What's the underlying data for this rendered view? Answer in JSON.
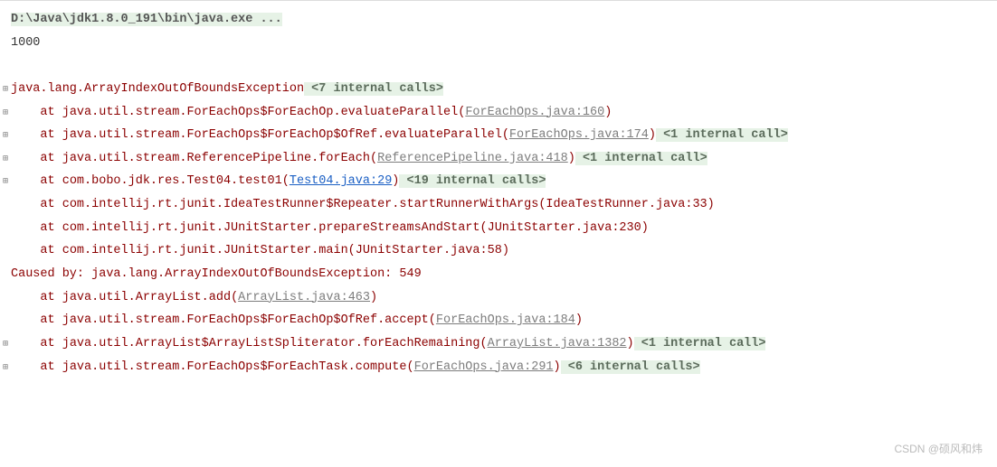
{
  "header": {
    "command": "D:\\Java\\jdk1.8.0_191\\bin\\java.exe ...",
    "output": "1000"
  },
  "trace": {
    "exception_class": "java.lang.ArrayIndexOutOfBoundsException",
    "badge_top": " <7 internal calls>",
    "frames": [
      {
        "at": "at ",
        "pkg": "java.util.stream.ForEachOps$ForEachOp.evaluateParallel",
        "open": "(",
        "link": "ForEachOps.java:160",
        "close": ")",
        "badge": "",
        "link_style": "grey",
        "fold": true
      },
      {
        "at": "at ",
        "pkg": "java.util.stream.ForEachOps$ForEachOp$OfRef.evaluateParallel",
        "open": "(",
        "link": "ForEachOps.java:174",
        "close": ")",
        "badge": " <1 internal call>",
        "link_style": "grey",
        "fold": true
      },
      {
        "at": "at ",
        "pkg": "java.util.stream.ReferencePipeline.forEach",
        "open": "(",
        "link": "ReferencePipeline.java:418",
        "close": ")",
        "badge": " <1 internal call>",
        "link_style": "grey",
        "fold": true
      },
      {
        "at": "at ",
        "pkg": "com.bobo.jdk.res.Test04.test01",
        "open": "(",
        "link": "Test04.java:29",
        "close": ")",
        "badge": " <19 internal calls>",
        "link_style": "blue",
        "fold": true
      },
      {
        "at": "at ",
        "pkg": "com.intellij.rt.junit.IdeaTestRunner$Repeater.startRunnerWithArgs",
        "open": "(",
        "link": "IdeaTestRunner.java:33",
        "close": ")",
        "badge": "",
        "link_style": "plain",
        "fold": false
      },
      {
        "at": "at ",
        "pkg": "com.intellij.rt.junit.JUnitStarter.prepareStreamsAndStart",
        "open": "(",
        "link": "JUnitStarter.java:230",
        "close": ")",
        "badge": "",
        "link_style": "plain",
        "fold": false
      },
      {
        "at": "at ",
        "pkg": "com.intellij.rt.junit.JUnitStarter.main",
        "open": "(",
        "link": "JUnitStarter.java:58",
        "close": ")",
        "badge": "",
        "link_style": "plain",
        "fold": false
      }
    ],
    "caused_by_label": "Caused by: ",
    "caused_by_exc": "java.lang.ArrayIndexOutOfBoundsException: 549",
    "caused_frames": [
      {
        "at": "at ",
        "pkg": "java.util.ArrayList.add",
        "open": "(",
        "link": "ArrayList.java:463",
        "close": ")",
        "badge": "",
        "link_style": "grey",
        "fold": false
      },
      {
        "at": "at ",
        "pkg": "java.util.stream.ForEachOps$ForEachOp$OfRef.accept",
        "open": "(",
        "link": "ForEachOps.java:184",
        "close": ")",
        "badge": "",
        "link_style": "grey",
        "fold": false
      },
      {
        "at": "at ",
        "pkg": "java.util.ArrayList$ArrayListSpliterator.forEachRemaining",
        "open": "(",
        "link": "ArrayList.java:1382",
        "close": ")",
        "badge": " <1 internal call>",
        "link_style": "grey",
        "fold": true
      },
      {
        "at": "at ",
        "pkg": "java.util.stream.ForEachOps$ForEachTask.compute",
        "open": "(",
        "link": "ForEachOps.java:291",
        "close": ")",
        "badge": " <6 internal calls>",
        "link_style": "grey",
        "fold": true
      }
    ]
  },
  "watermark": "CSDN @硕风和炜"
}
